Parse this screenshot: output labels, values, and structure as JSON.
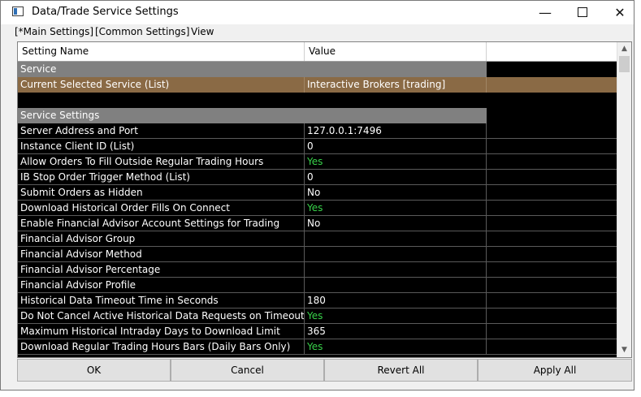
{
  "window": {
    "title": "Data/Trade Service Settings"
  },
  "menu": {
    "items": [
      "[*Main Settings]",
      "[Common Settings]",
      "View"
    ]
  },
  "grid": {
    "columns": [
      "Setting Name",
      "Value",
      ""
    ],
    "rows": [
      {
        "type": "section",
        "name": "Service",
        "value": ""
      },
      {
        "type": "selected",
        "name": "Current Selected Service (List)",
        "value": "Interactive Brokers    [trading]"
      },
      {
        "type": "blank",
        "name": "",
        "value": ""
      },
      {
        "type": "section",
        "name": "Service Settings",
        "value": ""
      },
      {
        "type": "normal",
        "name": "Server Address and Port",
        "value": "127.0.0.1:7496"
      },
      {
        "type": "normal",
        "name": "Instance Client ID (List)",
        "value": "0"
      },
      {
        "type": "yes",
        "name": "Allow Orders To Fill Outside Regular Trading Hours",
        "value": "Yes"
      },
      {
        "type": "normal",
        "name": "IB Stop Order Trigger Method (List)",
        "value": "0"
      },
      {
        "type": "normal",
        "name": "Submit Orders as Hidden",
        "value": "No"
      },
      {
        "type": "yes",
        "name": "Download Historical Order Fills On Connect",
        "value": "Yes"
      },
      {
        "type": "normal",
        "name": "Enable Financial Advisor Account Settings for Trading",
        "value": "No"
      },
      {
        "type": "normal",
        "name": "Financial Advisor Group",
        "value": ""
      },
      {
        "type": "normal",
        "name": "Financial Advisor Method",
        "value": ""
      },
      {
        "type": "normal",
        "name": "Financial Advisor Percentage",
        "value": ""
      },
      {
        "type": "normal",
        "name": "Financial Advisor Profile",
        "value": ""
      },
      {
        "type": "normal",
        "name": "Historical Data Timeout Time in Seconds",
        "value": "180"
      },
      {
        "type": "yes",
        "name": "Do Not Cancel Active Historical Data Requests on Timeout",
        "value": "Yes"
      },
      {
        "type": "normal",
        "name": "Maximum Historical Intraday Days to Download Limit",
        "value": "365"
      },
      {
        "type": "yes",
        "name": "Download Regular Trading Hours Bars (Daily Bars Only)",
        "value": "Yes"
      }
    ]
  },
  "buttons": {
    "ok": "OK",
    "cancel": "Cancel",
    "revert": "Revert All",
    "apply": "Apply All"
  },
  "colors": {
    "grid_background": "#000000",
    "section_header": "#808080",
    "selected_row": "#8a6a45",
    "yes_value": "#38d24a"
  },
  "icons": {
    "app": "app-window-icon",
    "minimize": "minimize-icon",
    "maximize": "maximize-icon",
    "close": "close-icon",
    "scroll_up": "chevron-up-icon",
    "scroll_down": "chevron-down-icon"
  }
}
